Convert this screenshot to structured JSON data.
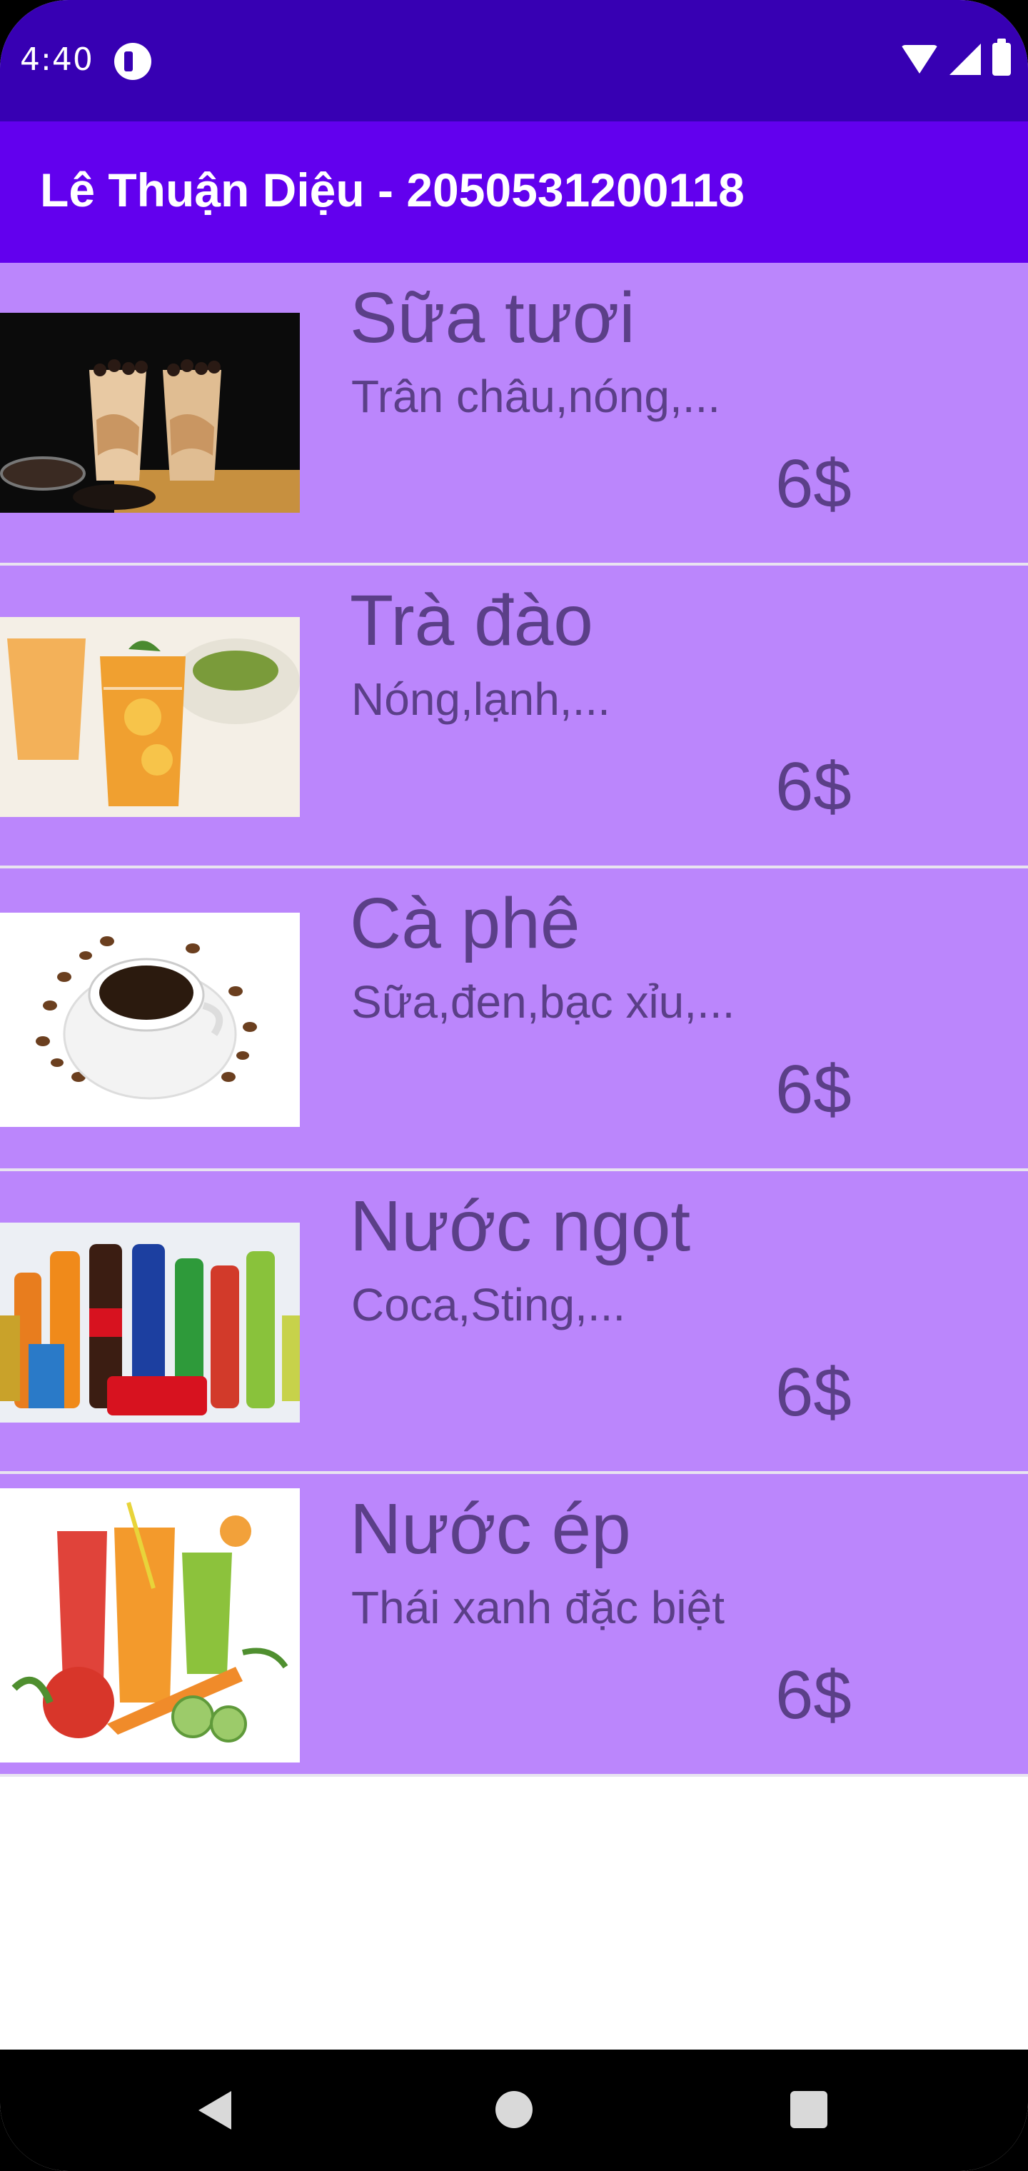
{
  "status_bar": {
    "time": "4:40",
    "icons": [
      "app-notification-icon",
      "wifi-icon",
      "signal-icon",
      "battery-icon"
    ]
  },
  "app_bar": {
    "title": "Lê Thuận Diệu - 2050531200118",
    "color": "#6200EE"
  },
  "colors": {
    "status_bar": "#3700B3",
    "item_background": "#BB86FC",
    "item_text": "#5B3F88"
  },
  "items": [
    {
      "name": "Sữa tươi",
      "description": "Trân châu,nóng,...",
      "price": "6$",
      "image": "milk-tea-image"
    },
    {
      "name": "Trà đào",
      "description": "Nóng,lạnh,...",
      "price": "6$",
      "image": "peach-tea-image"
    },
    {
      "name": "Cà phê",
      "description": "Sữa,đen,bạc xỉu,...",
      "price": "6$",
      "image": "coffee-image"
    },
    {
      "name": "Nước ngọt",
      "description": "Coca,Sting,...",
      "price": "6$",
      "image": "soft-drinks-image"
    },
    {
      "name": "Nước ép",
      "description": "Thái xanh đặc biệt",
      "price": "6$",
      "image": "juice-image"
    }
  ],
  "nav_bar": {
    "icons": [
      "back-icon",
      "home-icon",
      "recents-icon"
    ]
  }
}
